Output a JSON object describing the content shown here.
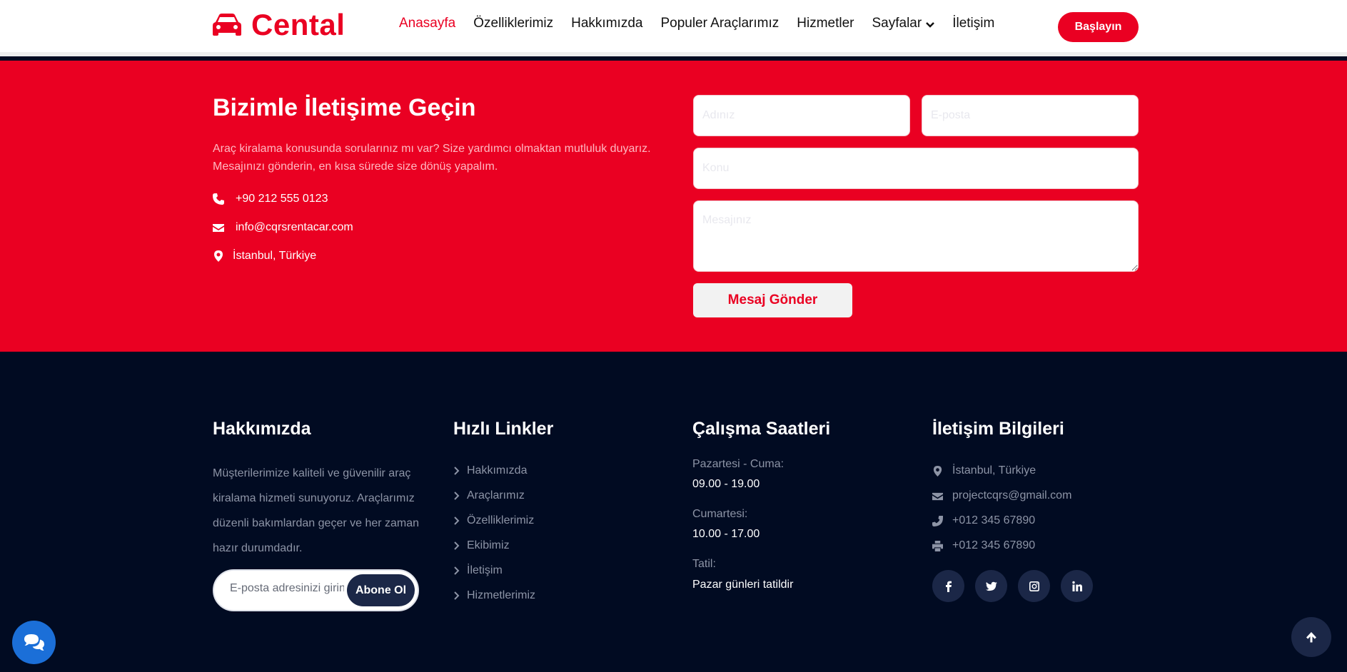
{
  "header": {
    "logo_text": "Cental",
    "nav": [
      {
        "label": "Anasayfa",
        "active": true
      },
      {
        "label": "Özelliklerimiz"
      },
      {
        "label": "Hakkımızda"
      },
      {
        "label": "Populer Araçlarımız"
      },
      {
        "label": "Hizmetler"
      },
      {
        "label": "Sayfalar",
        "has_dropdown": true
      },
      {
        "label": "İletişim"
      }
    ],
    "cta_label": "Başlayın"
  },
  "contact": {
    "title": "Bizimle İletişime Geçin",
    "description": "Araç kiralama konusunda sorularınız mı var? Size yardımcı olmaktan mutluluk duyarız. Mesajınızı gönderin, en kısa sürede size dönüş yapalım.",
    "phone": "+90 212 555 0123",
    "email": "info@cqrsrentacar.com",
    "address": "İstanbul, Türkiye",
    "form": {
      "name_placeholder": "Adınız",
      "email_placeholder": "E-posta",
      "subject_placeholder": "Konu",
      "message_placeholder": "Mesajınız",
      "submit_label": "Mesaj Gönder"
    }
  },
  "footer": {
    "about": {
      "title": "Hakkımızda",
      "text": "Müşterilerimize kaliteli ve güvenilir araç kiralama hizmeti sunuyoruz. Araçlarımız düzenli bakımlardan geçer ve her zaman hazır durumdadır.",
      "subscribe_placeholder": "E-posta adresinizi girin",
      "subscribe_button": "Abone Ol"
    },
    "quick_links": {
      "title": "Hızlı Linkler",
      "items": [
        "Hakkımızda",
        "Araçlarımız",
        "Özelliklerimiz",
        "Ekibimiz",
        "İletişim",
        "Hizmetlerimiz"
      ]
    },
    "hours": {
      "title": "Çalışma Saatleri",
      "weekdays_label": "Pazartesi - Cuma:",
      "weekdays_value": "09.00 - 19.00",
      "saturday_label": "Cumartesi:",
      "saturday_value": "10.00 - 17.00",
      "holiday_label": "Tatil:",
      "holiday_value": "Pazar günleri tatildir"
    },
    "contact_info": {
      "title": "İletişim Bilgileri",
      "address": "İstanbul, Türkiye",
      "email": "projectcqrs@gmail.com",
      "phone": "+012 345 67890",
      "fax": "+012 345 67890",
      "socials": [
        "facebook-icon",
        "twitter-icon",
        "instagram-icon",
        "linkedin-icon"
      ]
    }
  },
  "colors": {
    "accent": "#ea0022",
    "footer_bg": "#010b22",
    "button_dark": "#1b2747",
    "chat_blue": "#1b6fd8"
  }
}
